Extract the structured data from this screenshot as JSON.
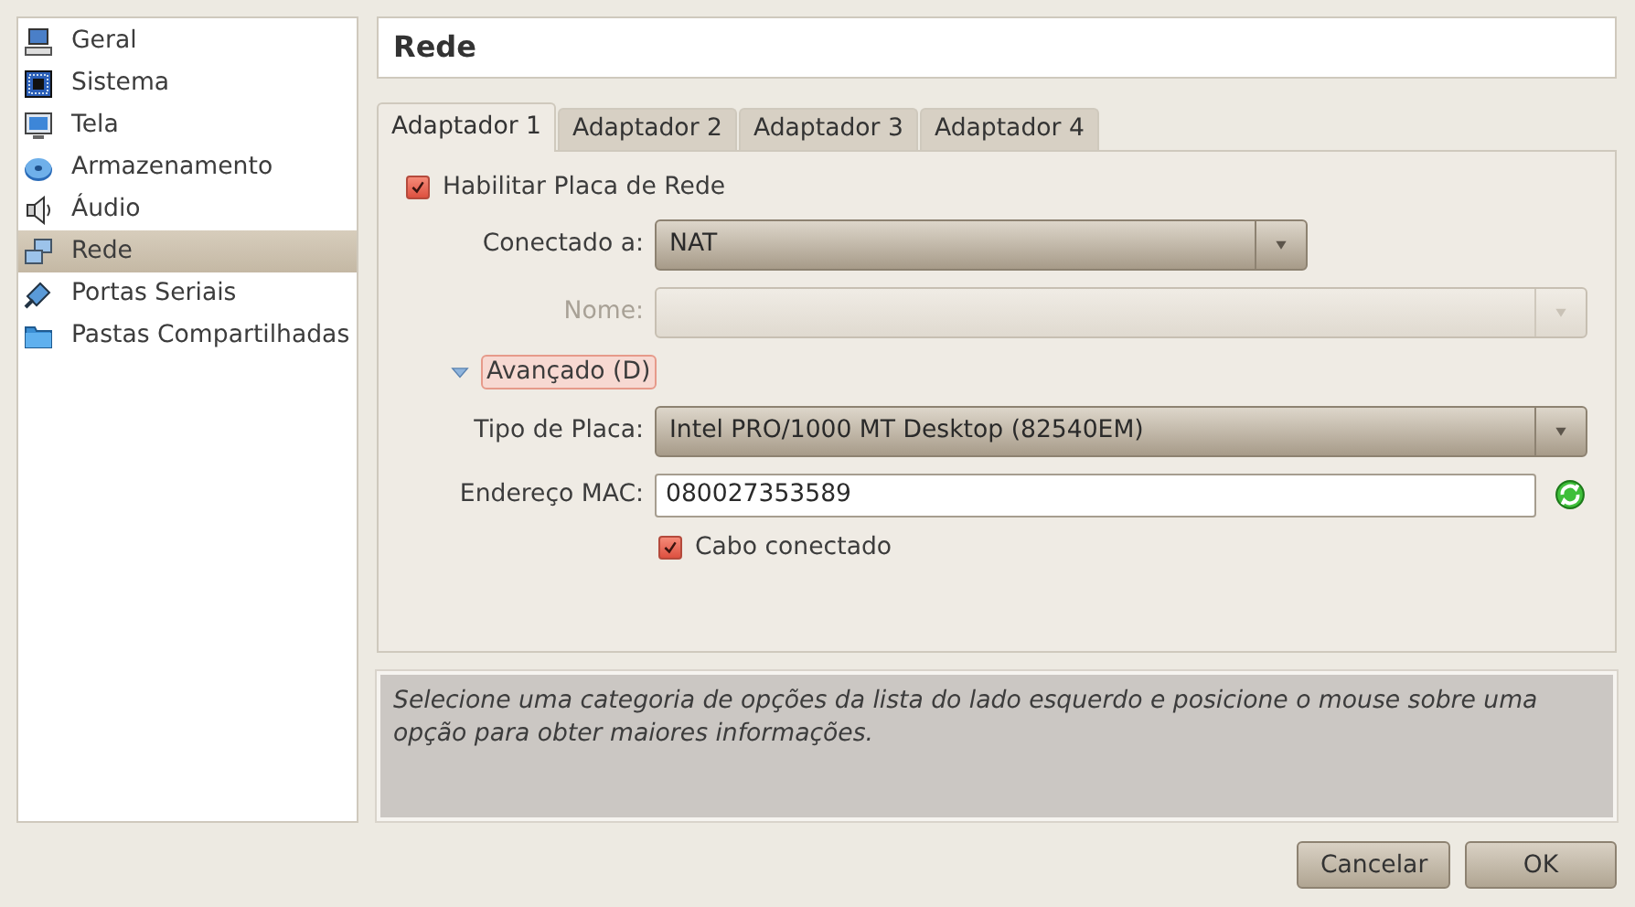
{
  "sidebar": {
    "items": [
      {
        "label": "Geral",
        "selected": false
      },
      {
        "label": "Sistema",
        "selected": false
      },
      {
        "label": "Tela",
        "selected": false
      },
      {
        "label": "Armazenamento",
        "selected": false
      },
      {
        "label": "Áudio",
        "selected": false
      },
      {
        "label": "Rede",
        "selected": true
      },
      {
        "label": "Portas Seriais",
        "selected": false
      },
      {
        "label": "Pastas Compartilhadas",
        "selected": false
      }
    ]
  },
  "page_title": "Rede",
  "tabs": [
    {
      "label": "Adaptador 1",
      "selected": true
    },
    {
      "label": "Adaptador 2",
      "selected": false
    },
    {
      "label": "Adaptador 3",
      "selected": false
    },
    {
      "label": "Adaptador 4",
      "selected": false
    }
  ],
  "enable_adapter": {
    "label": "Habilitar Placa de Rede",
    "checked": true
  },
  "attached_to": {
    "label": "Conectado a:",
    "value": "NAT",
    "disabled": false
  },
  "name": {
    "label": "Nome:",
    "disabled": true
  },
  "advanced": {
    "label": "Avançado (D)",
    "expanded": true
  },
  "adapter_type": {
    "label": "Tipo de Placa:",
    "value": "Intel PRO/1000 MT Desktop (82540EM)",
    "disabled": false
  },
  "mac_address": {
    "label": "Endereço MAC:",
    "value": "080027353589"
  },
  "cable_connected": {
    "label": "Cabo conectado",
    "checked": true
  },
  "info_text": "Selecione uma categoria de opções da lista do lado esquerdo e posicione o mouse sobre uma opção para obter maiores informações.",
  "buttons": [
    "Cancelar",
    "OK"
  ]
}
